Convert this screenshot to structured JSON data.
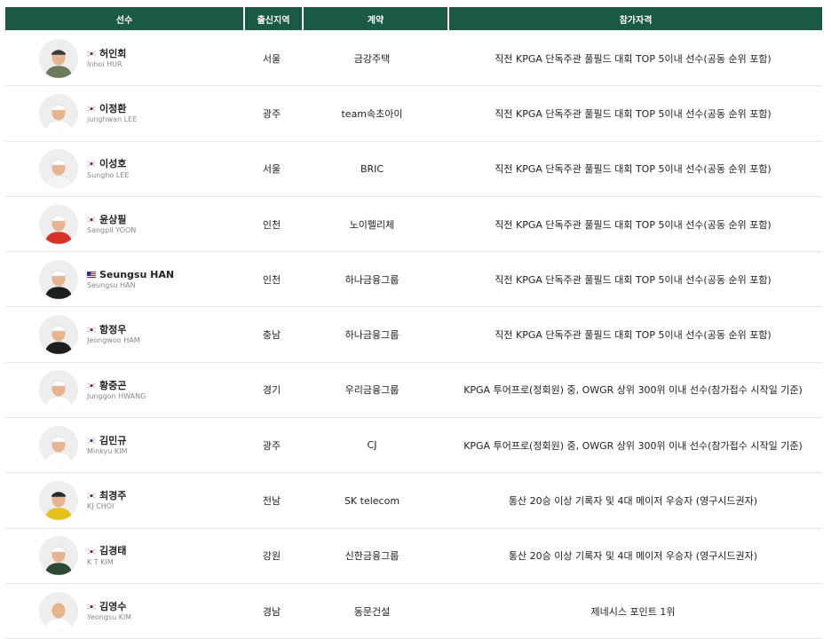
{
  "header": {
    "col_player": "선수",
    "col_region": "출신지역",
    "col_contract": "계약",
    "col_qualification": "참가자격"
  },
  "colors": {
    "header_bg": "#1a5a43",
    "header_text": "#ffffff",
    "row_border": "#e6e6e6"
  },
  "players": [
    {
      "name_kr": "허인회",
      "name_en": "Inhoi HUR",
      "flag": "kr-flag-icon",
      "region": "서울",
      "contract": "금강주택",
      "qualification": "직전 KPGA 단독주관 풀필드 대회 TOP 5이내 선수(공동 순위 포함)"
    },
    {
      "name_kr": "이정환",
      "name_en": "junghwan LEE",
      "flag": "kr-flag-icon",
      "region": "광주",
      "contract": "team속초아이",
      "qualification": "직전 KPGA 단독주관 풀필드 대회 TOP 5이내 선수(공동 순위 포함)"
    },
    {
      "name_kr": "이성호",
      "name_en": "Sungho LEE",
      "flag": "kr-flag-icon",
      "region": "서울",
      "contract": "BRIC",
      "qualification": "직전 KPGA 단독주관 풀필드 대회 TOP 5이내 선수(공동 순위 포함)"
    },
    {
      "name_kr": "윤상필",
      "name_en": "Sangpil YOON",
      "flag": "kr-flag-icon",
      "region": "인천",
      "contract": "노이펠리체",
      "qualification": "직전 KPGA 단독주관 풀필드 대회 TOP 5이내 선수(공동 순위 포함)"
    },
    {
      "name_kr": "Seungsu HAN",
      "name_en": "Seungsu HAN",
      "flag": "us-flag-icon",
      "region": "인천",
      "contract": "하나금융그룹",
      "qualification": "직전 KPGA 단독주관 풀필드 대회 TOP 5이내 선수(공동 순위 포함)"
    },
    {
      "name_kr": "함정우",
      "name_en": "Jeongwoo HAM",
      "flag": "kr-flag-icon",
      "region": "충남",
      "contract": "하나금융그룹",
      "qualification": "직전 KPGA 단독주관 풀필드 대회 TOP 5이내 선수(공동 순위 포함)"
    },
    {
      "name_kr": "황중곤",
      "name_en": "Junggon HWANG",
      "flag": "kr-flag-icon",
      "region": "경기",
      "contract": "우리금융그룹",
      "qualification": "KPGA 투어프로(정회원) 중, OWGR 상위 300위 이내 선수(참가접수 시작일 기준)"
    },
    {
      "name_kr": "김민규",
      "name_en": "Minkyu KIM",
      "flag": "kr-flag-icon",
      "region": "광주",
      "contract": "CJ",
      "qualification": "KPGA 투어프로(정회원) 중, OWGR 상위 300위 이내 선수(참가접수 시작일 기준)"
    },
    {
      "name_kr": "최경주",
      "name_en": "KJ CHOI",
      "flag": "kr-flag-icon",
      "region": "전남",
      "contract": "SK telecom",
      "qualification": "통산 20승 이상 기록자 및 4대 메이저 우승자 (영구시드권자)"
    },
    {
      "name_kr": "김경태",
      "name_en": "K T KIM",
      "flag": "kr-flag-icon",
      "region": "강원",
      "contract": "신한금융그룹",
      "qualification": "통산 20승 이상 기록자 및 4대 메이저 우승자 (영구시드권자)"
    },
    {
      "name_kr": "김영수",
      "name_en": "Yeongsu KIM",
      "flag": "kr-flag-icon",
      "region": "경남",
      "contract": "동문건설",
      "qualification": "제네시스 포인트 1위"
    }
  ]
}
